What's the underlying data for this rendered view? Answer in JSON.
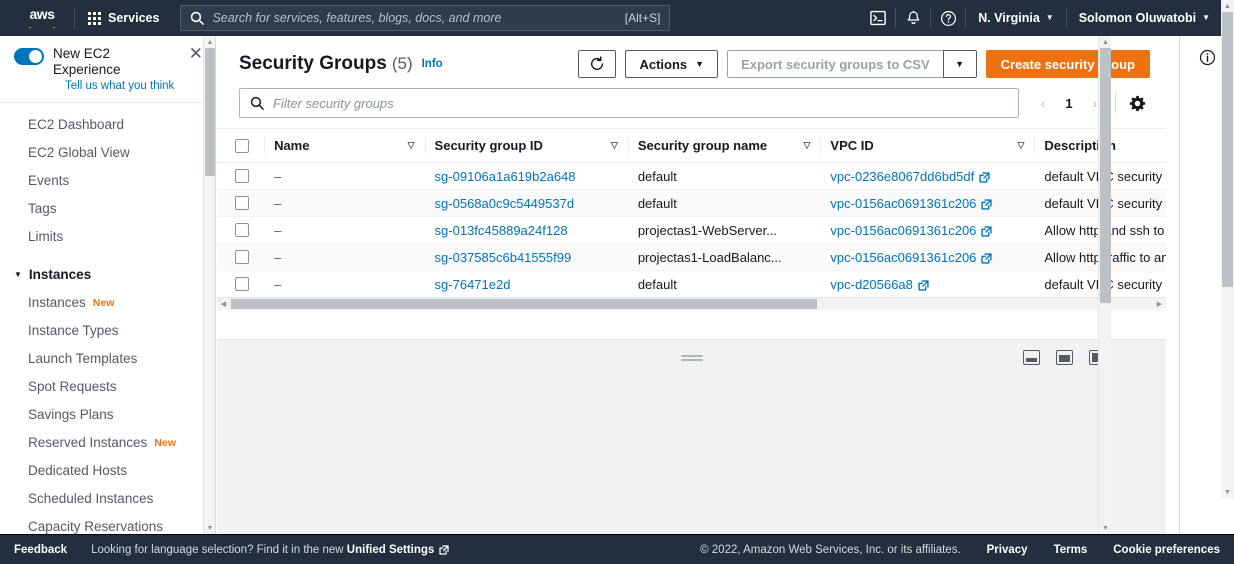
{
  "topnav": {
    "logo_word": "aws",
    "services_label": "Services",
    "search_placeholder": "Search for services, features, blogs, docs, and more",
    "search_value": "",
    "alt_hint": "[Alt+S]",
    "cloudshell_icon": "cloudshell-icon",
    "bell_icon": "bell-icon",
    "help_icon": "help-icon",
    "region_label": "N. Virginia",
    "account_label": "Solomon Oluwatobi"
  },
  "sidebar": {
    "experience": {
      "title": "New EC2 Experience",
      "subtitle": "Tell us what you think",
      "close_icon": "close-icon",
      "toggle_icon": "toggle-on-icon"
    },
    "items": [
      {
        "label": "EC2 Dashboard",
        "type": "link"
      },
      {
        "label": "EC2 Global View",
        "type": "link"
      },
      {
        "label": "Events",
        "type": "link"
      },
      {
        "label": "Tags",
        "type": "link"
      },
      {
        "label": "Limits",
        "type": "link"
      },
      {
        "label": "Instances",
        "type": "group",
        "badge": ""
      },
      {
        "label": "Instances",
        "type": "link",
        "badge": "New"
      },
      {
        "label": "Instance Types",
        "type": "link"
      },
      {
        "label": "Launch Templates",
        "type": "link"
      },
      {
        "label": "Spot Requests",
        "type": "link"
      },
      {
        "label": "Savings Plans",
        "type": "link"
      },
      {
        "label": "Reserved Instances",
        "type": "link",
        "badge": "New"
      },
      {
        "label": "Dedicated Hosts",
        "type": "link"
      },
      {
        "label": "Scheduled Instances",
        "type": "link"
      },
      {
        "label": "Capacity Reservations",
        "type": "link"
      }
    ]
  },
  "main": {
    "title": "Security Groups",
    "count": "(5)",
    "info_label": "Info",
    "refresh_icon": "refresh-icon",
    "actions_label": "Actions",
    "export_label": "Export security groups to CSV",
    "create_label": "Create security group",
    "filter_placeholder": "Filter security groups",
    "filter_value": "",
    "search_icon": "search-icon",
    "pagination": {
      "prev_icon": "chevron-left-icon",
      "page": "1",
      "next_icon": "chevron-right-icon",
      "settings_icon": "gear-icon"
    },
    "table": {
      "columns": [
        {
          "label": "Name",
          "sortable": true
        },
        {
          "label": "Security group ID",
          "sortable": true
        },
        {
          "label": "Security group name",
          "sortable": true
        },
        {
          "label": "VPC ID",
          "sortable": true
        },
        {
          "label": "Description",
          "sortable": true
        }
      ],
      "rows": [
        {
          "name": "–",
          "sg_id": "sg-09106a1a619b2a648",
          "sg_name": "default",
          "vpc_id": "vpc-0236e8067dd6bd5df",
          "description": "default VPC security gr.."
        },
        {
          "name": "–",
          "sg_id": "sg-0568a0c9c5449537d",
          "sg_name": "default",
          "vpc_id": "vpc-0156ac0691361c206",
          "description": "default VPC security gr.."
        },
        {
          "name": "–",
          "sg_id": "sg-013fc45889a24f128",
          "sg_name": "projectas1-WebServer...",
          "vpc_id": "vpc-0156ac0691361c206",
          "description": "Allow http and ssh to ..."
        },
        {
          "name": "–",
          "sg_id": "sg-037585c6b41555f99",
          "sg_name": "projectas1-LoadBalanc...",
          "vpc_id": "vpc-0156ac0691361c206",
          "description": "Allow http traffic to an.."
        },
        {
          "name": "–",
          "sg_id": "sg-76471e2d",
          "sg_name": "default",
          "vpc_id": "vpc-d20566a8",
          "description": "default VPC security gr.."
        }
      ]
    },
    "view_modes": [
      "split-bottom-small-icon",
      "split-bottom-medium-icon",
      "split-bottom-large-icon"
    ],
    "resize_handle": "panel-resize-handle"
  },
  "helppanel": {
    "info_icon": "info-circle-icon"
  },
  "footer": {
    "feedback_label": "Feedback",
    "language_text_prefix": "Looking for language selection? Find it in the new ",
    "language_link": "Unified Settings",
    "copyright": "© 2022, Amazon Web Services, Inc. or its affiliates.",
    "privacy_label": "Privacy",
    "terms_label": "Terms",
    "cookie_label": "Cookie preferences"
  },
  "colors": {
    "nav_bg": "#232f3e",
    "accent_orange": "#ec7211",
    "link_blue": "#0073bb",
    "text": "#16191f"
  }
}
